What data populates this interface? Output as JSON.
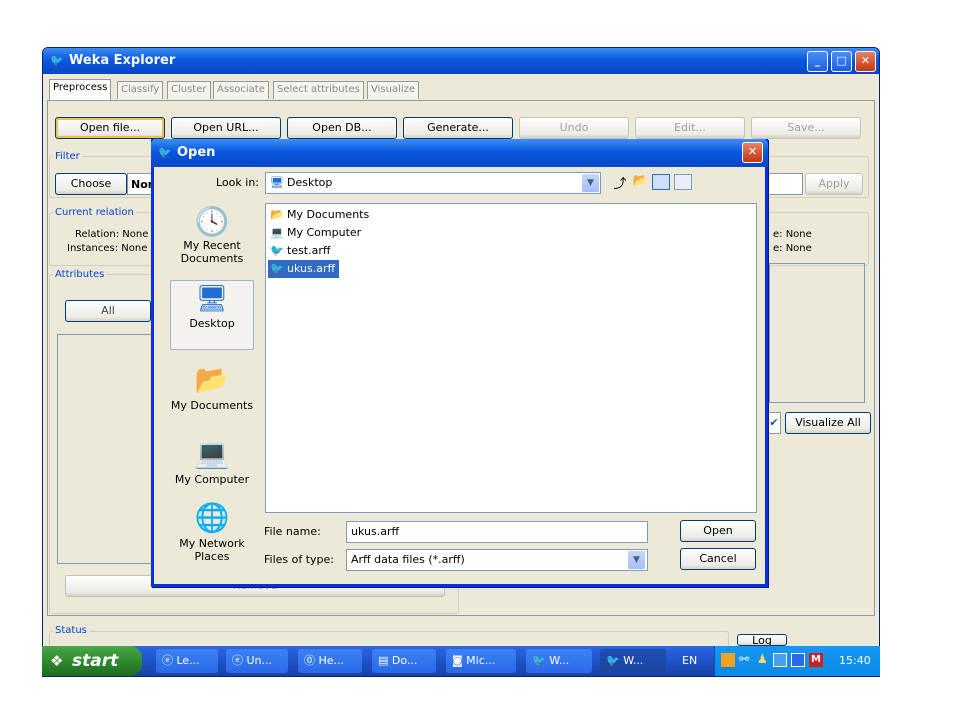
{
  "weka": {
    "title": "Weka Explorer",
    "tabs": [
      "Preprocess",
      "Classify",
      "Cluster",
      "Associate",
      "Select attributes",
      "Visualize"
    ],
    "buttons": {
      "open_file": "Open file...",
      "open_url": "Open URL...",
      "open_db": "Open DB...",
      "generate": "Generate...",
      "undo": "Undo",
      "edit": "Edit...",
      "save": "Save..."
    },
    "filter": {
      "label": "Filter",
      "choose": "Choose",
      "value": "None",
      "apply": "Apply"
    },
    "current_relation": {
      "label": "Current relation",
      "relation": "Relation: None",
      "instances": "Instances: None",
      "right_line1": "e: None",
      "right_line2": "e: None"
    },
    "attributes": {
      "label": "Attributes",
      "all": "All",
      "remove": "Remove"
    },
    "visualize_all": "Visualize All",
    "status": {
      "label": "Status",
      "log": "Log"
    }
  },
  "dialog": {
    "title": "Open",
    "look_in_label": "Look in:",
    "look_in_value": "Desktop",
    "places": [
      {
        "label": "My Recent Documents",
        "icon": "recent-documents-icon"
      },
      {
        "label": "Desktop",
        "icon": "desktop-icon"
      },
      {
        "label": "My Documents",
        "icon": "my-documents-icon"
      },
      {
        "label": "My Computer",
        "icon": "my-computer-icon"
      },
      {
        "label": "My Network Places",
        "icon": "network-places-icon"
      }
    ],
    "files": [
      {
        "name": "My Documents",
        "icon": "folder-icon"
      },
      {
        "name": "My Computer",
        "icon": "computer-icon"
      },
      {
        "name": "test.arff",
        "icon": "weka-file-icon"
      },
      {
        "name": "ukus.arff",
        "icon": "weka-file-icon"
      }
    ],
    "selected_file": "ukus.arff",
    "file_name_label": "File name:",
    "file_name_value": "ukus.arff",
    "files_of_type_label": "Files of type:",
    "files_of_type_value": "Arff data files (*.arff)",
    "open_button": "Open",
    "cancel_button": "Cancel"
  },
  "taskbar": {
    "start": "start",
    "tasks": [
      "Le...",
      "Un...",
      "He...",
      "Do...",
      "Mic...",
      "W...",
      "W..."
    ],
    "language": "EN",
    "clock": "15:40"
  },
  "colors": {
    "xp_blue": "#0a58e0",
    "selection": "#316ac5",
    "window_face": "#ece9d8",
    "start_green": "#2e8b2e"
  }
}
